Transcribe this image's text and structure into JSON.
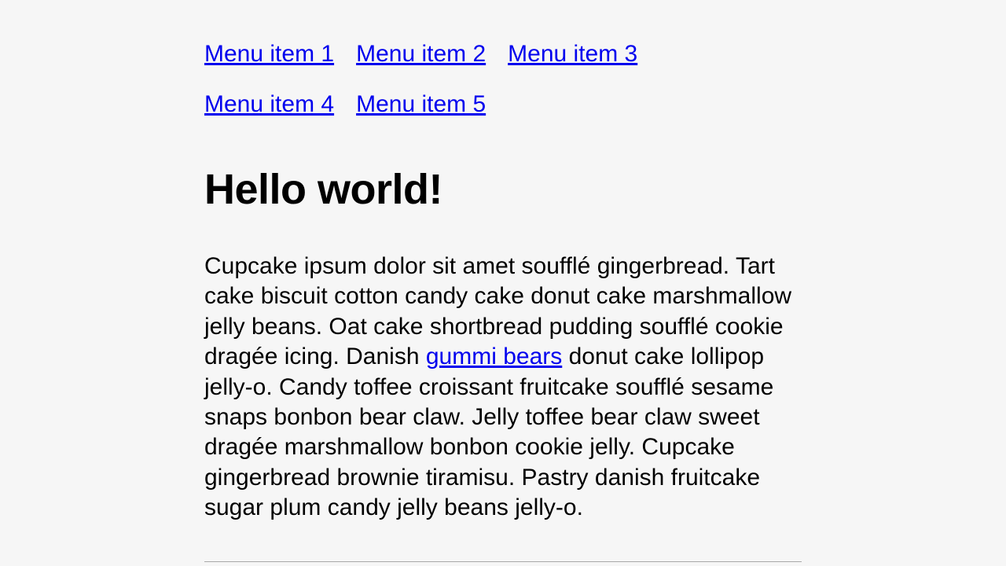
{
  "nav": {
    "items": [
      {
        "label": "Menu item 1"
      },
      {
        "label": "Menu item 2"
      },
      {
        "label": "Menu item 3"
      },
      {
        "label": "Menu item 4"
      },
      {
        "label": "Menu item 5"
      }
    ]
  },
  "heading": "Hello world!",
  "paragraph": {
    "before_link": "Cupcake ipsum dolor sit amet soufflé gingerbread. Tart cake biscuit cotton candy cake donut cake marshmallow jelly beans. Oat cake shortbread pudding soufflé cookie dragée icing. Danish ",
    "link_text": "gummi bears",
    "after_link": " donut cake lollipop jelly-o. Candy toffee croissant fruitcake soufflé sesame snaps bonbon bear claw. Jelly toffee bear claw sweet dragée marshmallow bonbon cookie jelly. Cupcake gingerbread brownie tiramisu. Pastry danish fruitcake sugar plum candy jelly beans jelly-o."
  }
}
